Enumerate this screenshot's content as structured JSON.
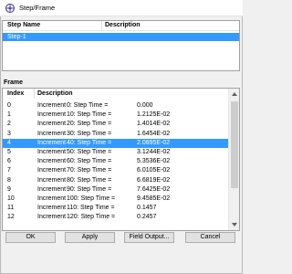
{
  "window": {
    "title": "Step/Frame",
    "icon": "step-frame-app-icon"
  },
  "step_table": {
    "headers": {
      "name": "Step Name",
      "description": "Description"
    },
    "rows": [
      {
        "name": "Step-1",
        "description": ""
      }
    ],
    "selected_index": 0
  },
  "frame_section": {
    "label": "Frame"
  },
  "frame_table": {
    "headers": {
      "index": "Index",
      "description": "Description"
    },
    "selected_index": 4,
    "rows": [
      {
        "index": "0",
        "increment": "Increment",
        "step": "0: Step Time =",
        "value": "0.000"
      },
      {
        "index": "1",
        "increment": "Increment",
        "step": "10: Step Time =",
        "value": "1.2125E-02"
      },
      {
        "index": "2",
        "increment": "Increment",
        "step": "20: Step Time =",
        "value": "1.4014E-02"
      },
      {
        "index": "3",
        "increment": "Increment",
        "step": "30: Step Time =",
        "value": "1.6454E-02"
      },
      {
        "index": "4",
        "increment": "Increment",
        "step": "40: Step Time =",
        "value": "2.0895E-02"
      },
      {
        "index": "5",
        "increment": "Increment",
        "step": "50: Step Time =",
        "value": "3.1244E-02"
      },
      {
        "index": "6",
        "increment": "Increment",
        "step": "60: Step Time =",
        "value": "5.3536E-02"
      },
      {
        "index": "7",
        "increment": "Increment",
        "step": "70: Step Time =",
        "value": "6.0105E-02"
      },
      {
        "index": "8",
        "increment": "Increment",
        "step": "80: Step Time =",
        "value": "6.6819E-02"
      },
      {
        "index": "9",
        "increment": "Increment",
        "step": "90: Step Time =",
        "value": "7.6425E-02"
      },
      {
        "index": "10",
        "increment": "Increment",
        "step": "100: Step Time =",
        "value": "9.4585E-02"
      },
      {
        "index": "11",
        "increment": "Increment",
        "step": "110: Step Time =",
        "value": "0.1457"
      },
      {
        "index": "12",
        "increment": "Increment",
        "step": "120: Step Time =",
        "value": "0.2457"
      }
    ]
  },
  "buttons": {
    "ok": "OK",
    "apply": "Apply",
    "field_output": "Field Output...",
    "cancel": "Cancel"
  },
  "colors": {
    "selection": "#3399ff",
    "window_bg": "#f0f0f0"
  }
}
